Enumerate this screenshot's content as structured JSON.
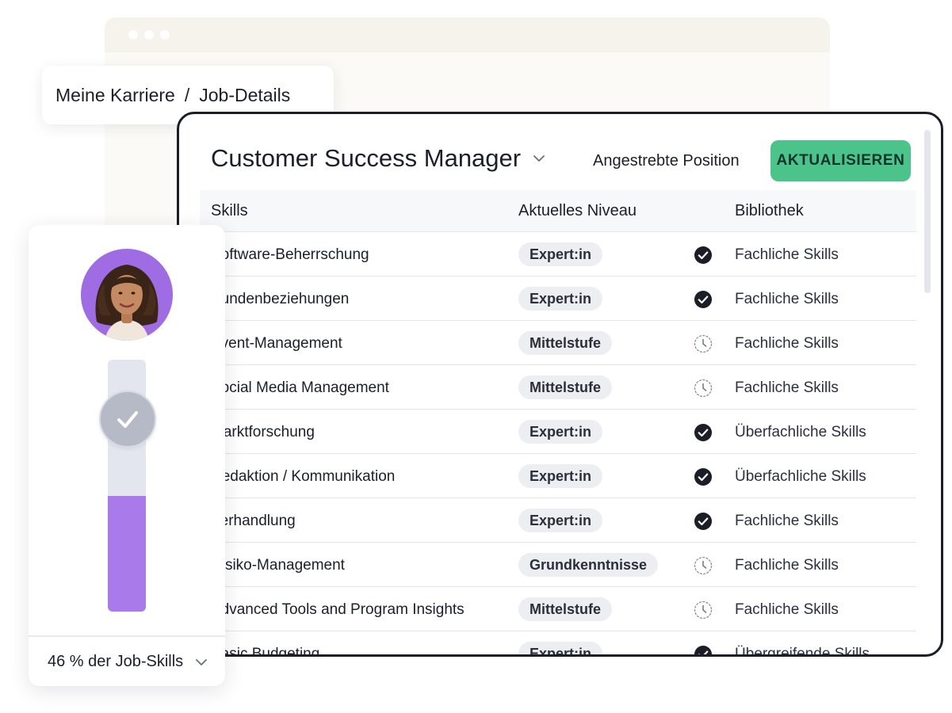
{
  "breadcrumb": {
    "parent": "Meine Karriere",
    "separator": "/",
    "current": "Job-Details"
  },
  "panel": {
    "job_title": "Customer Success Manager",
    "target_label": "Angestrebte Position",
    "update_button": "AKTUALISIEREN"
  },
  "table": {
    "columns": {
      "skills": "Skills",
      "level": "Aktuelles Niveau",
      "library": "Bibliothek"
    },
    "rows": [
      {
        "skill": "Software-Beherrschung",
        "level": "Expert:in",
        "status": "check-icon",
        "library": "Fachliche Skills"
      },
      {
        "skill": "Kundenbeziehungen",
        "level": "Expert:in",
        "status": "check-icon",
        "library": "Fachliche Skills"
      },
      {
        "skill": "Event-Management",
        "level": "Mittelstufe",
        "status": "clock-icon",
        "library": "Fachliche Skills"
      },
      {
        "skill": "Social Media Management",
        "level": "Mittelstufe",
        "status": "clock-icon",
        "library": "Fachliche Skills"
      },
      {
        "skill": "Marktforschung",
        "level": "Expert:in",
        "status": "check-icon",
        "library": "Überfachliche Skills"
      },
      {
        "skill": "Redaktion / Kommunikation",
        "level": "Expert:in",
        "status": "check-icon",
        "library": "Überfachliche Skills"
      },
      {
        "skill": "Verhandlung",
        "level": "Expert:in",
        "status": "check-icon",
        "library": "Fachliche Skills"
      },
      {
        "skill": "Risiko-Management",
        "level": "Grundkenntnisse",
        "status": "clock-icon",
        "library": "Fachliche Skills"
      },
      {
        "skill": "Advanced Tools and Program Insights",
        "level": "Mittelstufe",
        "status": "clock-icon",
        "library": "Fachliche Skills"
      },
      {
        "skill": "Basic Budgeting",
        "level": "Expert:in",
        "status": "check-icon",
        "library": "Übergreifende Skills"
      }
    ]
  },
  "profile": {
    "progress_fraction": 0.46,
    "footer_label": "46 % der Job-Skills"
  },
  "colors": {
    "accent": "#4cc38a",
    "progress": "#a97aea",
    "avatar_bg": "#9f6ce3",
    "border": "#1b1e27"
  }
}
